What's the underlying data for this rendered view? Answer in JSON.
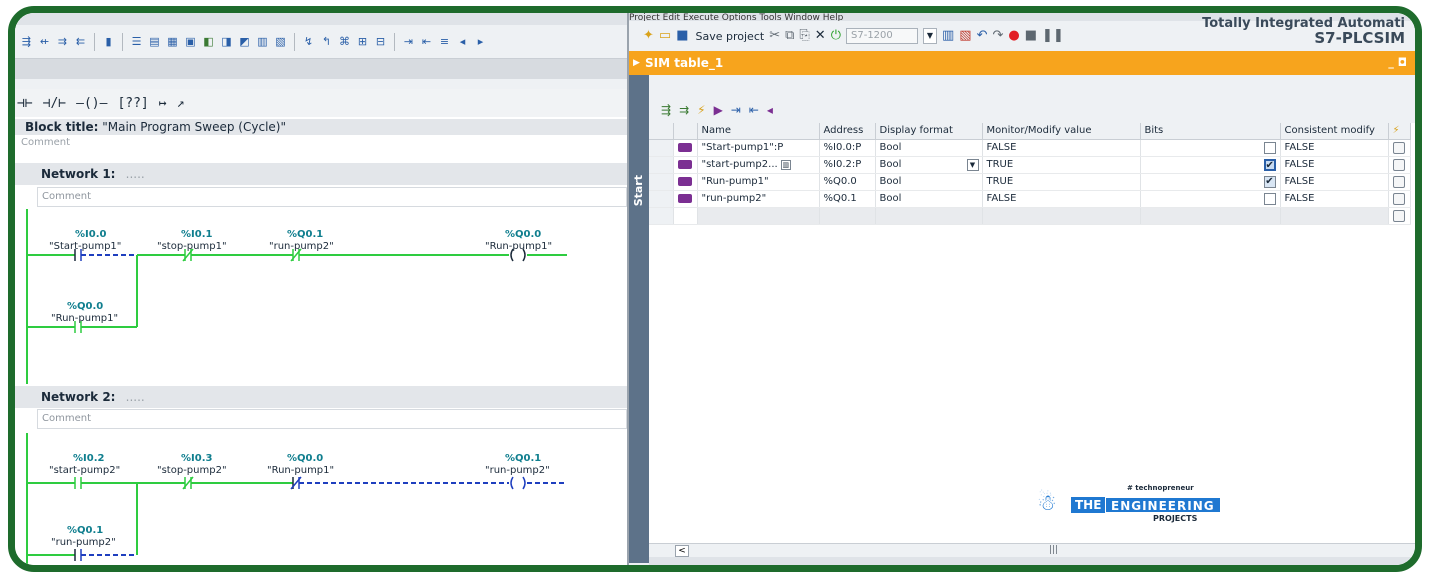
{
  "left": {
    "ladder_toolbar": [
      "⊣⊢",
      "⊣/⊢",
      "—()—",
      "[??]",
      "↦",
      "↗"
    ],
    "block_title_label": "Block title:",
    "block_title_value": "\"Main Program Sweep (Cycle)\"",
    "comment_placeholder": "Comment",
    "network1": {
      "title": "Network 1:",
      "dots": ".....",
      "comment": "Comment",
      "contacts": [
        {
          "addr": "%I0.0",
          "tag": "\"Start-pump1\""
        },
        {
          "addr": "%I0.1",
          "tag": "\"stop-pump1\""
        },
        {
          "addr": "%Q0.1",
          "tag": "\"run-pump2\""
        },
        {
          "addr": "%Q0.0",
          "tag": "\"Run-pump1\""
        }
      ],
      "parallel": {
        "addr": "%Q0.0",
        "tag": "\"Run-pump1\""
      }
    },
    "network2": {
      "title": "Network 2:",
      "dots": ".....",
      "comment": "Comment",
      "contacts": [
        {
          "addr": "%I0.2",
          "tag": "\"start-pump2\""
        },
        {
          "addr": "%I0.3",
          "tag": "\"stop-pump2\""
        },
        {
          "addr": "%Q0.0",
          "tag": "\"Run-pump1\""
        },
        {
          "addr": "%Q0.1",
          "tag": "\"run-pump2\""
        }
      ],
      "parallel": {
        "addr": "%Q0.1",
        "tag": "\"run-pump2\""
      }
    }
  },
  "right": {
    "menu": "Project   Edit   Execute   Options   Tools   Window   Help",
    "save_label": "Save project",
    "cpu_value": "S7-1200",
    "app_title_1": "Totally Integrated Automati",
    "app_title_2": "S7-PLCSIM",
    "sim_table_title": "SIM table_1",
    "start_tab": "Start",
    "columns": [
      "Name",
      "Address",
      "Display format",
      "Monitor/Modify value",
      "Bits",
      "Consistent modify"
    ],
    "rows": [
      {
        "name": "\"Start-pump1\":P",
        "address": "%I0.0:P",
        "format": "Bool",
        "value": "FALSE",
        "bit": "unchecked",
        "consistent": "FALSE"
      },
      {
        "name": "\"start-pump2...",
        "address": "%I0.2:P",
        "format": "Bool",
        "value": "TRUE",
        "bit": "selected",
        "consistent": "FALSE"
      },
      {
        "name": "\"Run-pump1\"",
        "address": "%Q0.0",
        "format": "Bool",
        "value": "TRUE",
        "bit": "checked",
        "consistent": "FALSE"
      },
      {
        "name": "\"run-pump2\"",
        "address": "%Q0.1",
        "format": "Bool",
        "value": "FALSE",
        "bit": "unchecked",
        "consistent": "FALSE"
      }
    ]
  },
  "logo": {
    "hashtag": "# technopreneur",
    "the": "THE",
    "engineering": "ENGINEERING",
    "projects": "PROJECTS"
  },
  "colors": {
    "frame": "#1e6b2c",
    "rung": "#2ecc40",
    "dashed": "#1f3fbf",
    "sim_header": "#f7a41d",
    "addr": "#0f7e8e"
  }
}
